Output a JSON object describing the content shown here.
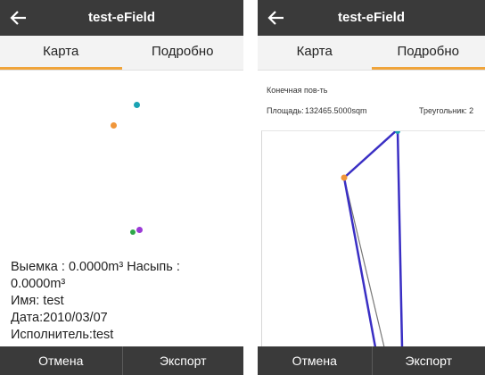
{
  "left": {
    "title": "test-eField",
    "tabs": [
      "Карта",
      "Подробно"
    ],
    "info": {
      "volume": "Выемка : 0.0000m³ Насыпь : 0.0000m³",
      "name": "Имя: test",
      "date": "Дата:2010/03/07",
      "executor": "Исполнитель:test"
    },
    "buttons": [
      "Отмена",
      "Экспорт"
    ],
    "point_colors": [
      "#1aa3b3",
      "#f0963a",
      "#2fa84a",
      "#9b3ad6"
    ]
  },
  "right": {
    "title": "test-eField",
    "tabs": [
      "Карта",
      "Подробно"
    ],
    "surface_label": "Конечная пов-ть",
    "area_label": "Площадь:",
    "area_value": "132465.5000sqm",
    "triangle_label": "Треугольник: 2",
    "buttons": [
      "Отмена",
      "Экспорт"
    ],
    "line_color": "#3a2fc4",
    "point_colors": [
      "#1aa3b3",
      "#f0963a"
    ]
  },
  "colors": {
    "accent": "#f0a43a",
    "bar": "#3a3a3a"
  }
}
